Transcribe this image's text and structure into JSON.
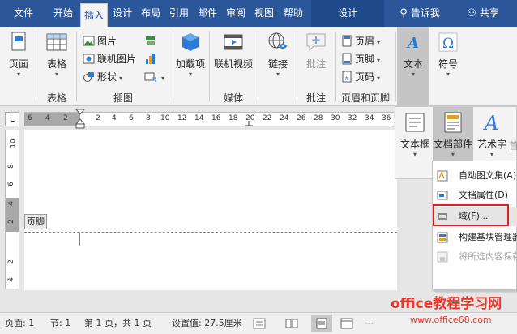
{
  "tabs": [
    {
      "label": "文件"
    },
    {
      "label": "开始"
    },
    {
      "label": "插入"
    },
    {
      "label": "设计"
    },
    {
      "label": "布局"
    },
    {
      "label": "引用"
    },
    {
      "label": "邮件"
    },
    {
      "label": "审阅"
    },
    {
      "label": "视图"
    },
    {
      "label": "帮助"
    },
    {
      "label": "设计"
    }
  ],
  "tell_me": "告诉我",
  "share": "共享",
  "ribbon": {
    "page": "页面",
    "table": "表格",
    "table_group": "表格",
    "picture": "图片",
    "online_picture": "联机图片",
    "shapes": "形状",
    "illustrations_group": "插图",
    "addins": "加载项",
    "online_video": "联机视频",
    "media_group": "媒体",
    "link": "链接",
    "comment": "批注",
    "comment_group": "批注",
    "header": "页眉",
    "footer": "页脚",
    "page_number": "页码",
    "header_footer_group": "页眉和页脚",
    "text": "文本",
    "symbols": "符号",
    "textbox": "文本框",
    "quick_parts": "文档部件",
    "wordart": "艺术字",
    "dropcap_partial": "首"
  },
  "ruler": {
    "h_ticks": [
      "6",
      "4",
      "2",
      "2",
      "4",
      "6",
      "8",
      "10",
      "12",
      "14",
      "16",
      "18",
      "20",
      "22",
      "24",
      "26",
      "28",
      "30",
      "32",
      "34",
      "36"
    ],
    "v_ticks": [
      "10",
      "8",
      "6",
      "4",
      "2",
      "2",
      "4"
    ]
  },
  "footer_tag": "页脚",
  "menu": {
    "items": [
      {
        "label": "自动图文集(A)"
      },
      {
        "label": "文档属性(D)"
      },
      {
        "label": "域(F)..."
      },
      {
        "label": "构建基块管理器(B)"
      },
      {
        "label": "将所选内容保存到文档部件库(S)..."
      }
    ]
  },
  "status": {
    "page": "页面: 1",
    "section": "节: 1",
    "pages": "第 1 页，共 1 页",
    "setting": "设置值: 27.5厘米"
  },
  "watermark": "office教程学习网",
  "watermark_url": "www.office68.com",
  "colors": {
    "accent": "#2b579a",
    "highlight_box": "#e02020",
    "watermark": "#e8372c"
  }
}
